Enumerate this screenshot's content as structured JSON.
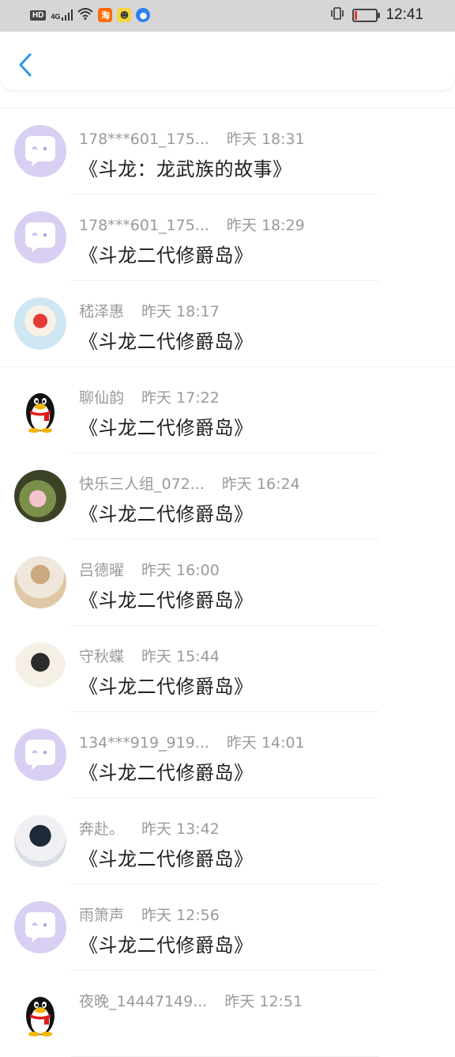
{
  "status_bar": {
    "left_labels": [
      "HD",
      "4G"
    ],
    "taobao_label": "淘",
    "time": "12:41"
  },
  "header": {
    "back_icon": "chevron-left-icon"
  },
  "messages": [
    {
      "name": "178***601_175...",
      "time": "昨天 18:31",
      "title": "《斗龙：龙武族的故事》",
      "avatar": "default"
    },
    {
      "name": "178***601_175...",
      "time": "昨天 18:29",
      "title": "《斗龙二代修爵岛》",
      "avatar": "default"
    },
    {
      "name": "嵇泽惠",
      "time": "昨天 18:17",
      "title": "《斗龙二代修爵岛》",
      "avatar": "photo-cake"
    },
    {
      "name": "聊仙韵",
      "time": "昨天 17:22",
      "title": "《斗龙二代修爵岛》",
      "avatar": "penguin"
    },
    {
      "name": "快乐三人组_072...",
      "time": "昨天 16:24",
      "title": "《斗龙二代修爵岛》",
      "avatar": "photo-flower"
    },
    {
      "name": "吕德曜",
      "time": "昨天 16:00",
      "title": "《斗龙二代修爵岛》",
      "avatar": "photo-figure"
    },
    {
      "name": "守秋蝶",
      "time": "昨天 15:44",
      "title": "《斗龙二代修爵岛》",
      "avatar": "photo-anime"
    },
    {
      "name": "134***919_919...",
      "time": "昨天 14:01",
      "title": "《斗龙二代修爵岛》",
      "avatar": "default"
    },
    {
      "name": "奔赴。",
      "time": "昨天 13:42",
      "title": "《斗龙二代修爵岛》",
      "avatar": "photo-anime-boy"
    },
    {
      "name": "雨箫声",
      "time": "昨天 12:56",
      "title": "《斗龙二代修爵岛》",
      "avatar": "default"
    },
    {
      "name": "夜晚_14447149...",
      "time": "昨天 12:51",
      "title": "",
      "avatar": "penguin"
    }
  ],
  "colors": {
    "accent_blue": "#2a9ae6",
    "default_avatar_bg": "#d9cff2",
    "meta_text": "#9a9a9a",
    "title_text": "#1f1f1f"
  }
}
